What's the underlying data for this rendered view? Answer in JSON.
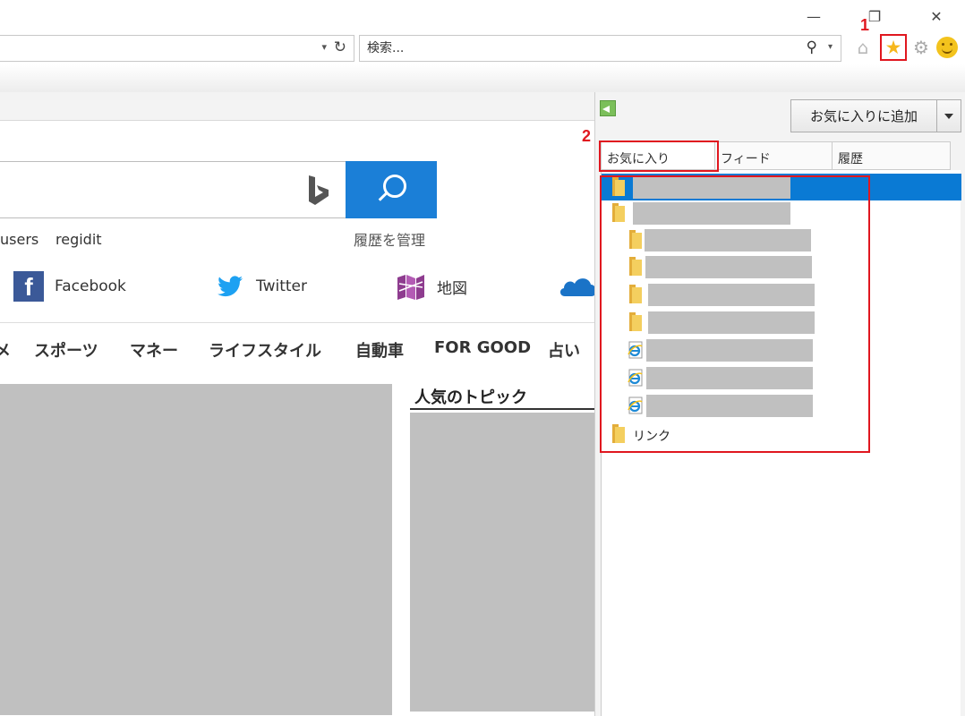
{
  "window": {
    "minimize_glyph": "—",
    "restore_glyph": "❐",
    "close_glyph": "✕"
  },
  "address_bar": {
    "dropdown_glyph": "▾",
    "refresh_glyph": "↻"
  },
  "search_box": {
    "placeholder": "検索...",
    "search_icon": "search-icon",
    "dropdown_glyph": "▾"
  },
  "toolbar_icons": {
    "home": "home-icon",
    "favorites": "star-icon",
    "favorites_glyph": "★",
    "home_glyph": "⌂",
    "tools": "gear-icon",
    "tools_glyph": "⚙",
    "feedback": "smiley-icon"
  },
  "annotations": {
    "step1": "1",
    "step2": "2",
    "highlight_color": "#e0171f"
  },
  "page": {
    "history_link": "履歴を管理",
    "user_links": [
      "users",
      "regidit"
    ],
    "social": [
      {
        "label": "Facebook",
        "icon": "facebook-icon"
      },
      {
        "label": "Twitter",
        "icon": "twitter-icon"
      },
      {
        "label": "地図",
        "icon": "map-icon"
      }
    ],
    "categories": [
      "メ",
      "スポーツ",
      "マネー",
      "ライフスタイル",
      "自動車",
      "FOR GOOD",
      "占い"
    ],
    "topics_title": "人気のトピック",
    "bing_accent": "#1b7fd7"
  },
  "favorites_center": {
    "add_button": "お気に入りに追加",
    "tabs": [
      {
        "label": "お気に入り",
        "active": true
      },
      {
        "label": "フィード",
        "active": false
      },
      {
        "label": "履歴",
        "active": false
      }
    ],
    "items": [
      {
        "type": "folder",
        "label": "",
        "selected": true
      },
      {
        "type": "folder",
        "label": "",
        "selected": false
      },
      {
        "type": "folder",
        "label": "",
        "selected": false
      },
      {
        "type": "folder",
        "label": "",
        "selected": false
      },
      {
        "type": "folder",
        "label": "",
        "selected": false
      },
      {
        "type": "folder",
        "label": "",
        "selected": false
      },
      {
        "type": "link",
        "label": "",
        "selected": false
      },
      {
        "type": "link",
        "label": "",
        "selected": false
      },
      {
        "type": "link",
        "label": "",
        "selected": false
      },
      {
        "type": "folder",
        "label": "リンク",
        "selected": false
      }
    ],
    "selection_color": "#0a7ad4"
  }
}
